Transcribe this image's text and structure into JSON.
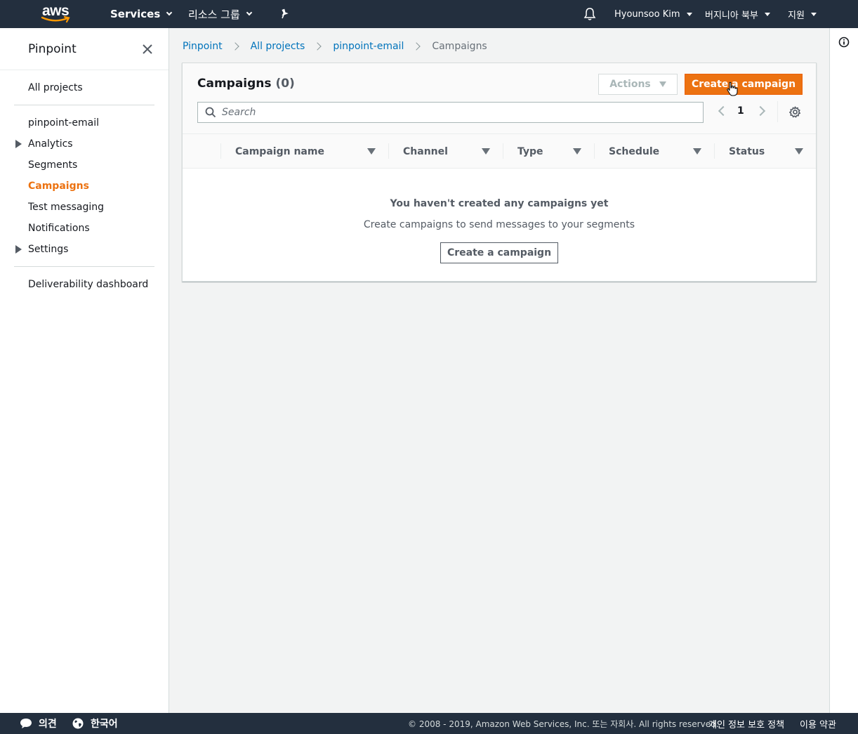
{
  "topnav": {
    "logo_text": "aws",
    "services_label": "Services",
    "resource_groups_label": "리소스 그룹",
    "user_label": "Hyounsoo Kim",
    "region_label": "버지니아 북부",
    "support_label": "지원",
    "icons": [
      "caret-down-icon",
      "pin-icon",
      "bell-icon"
    ]
  },
  "sidebar": {
    "title": "Pinpoint",
    "items": [
      {
        "label": "All projects"
      },
      {
        "label": "pinpoint-email"
      },
      {
        "label": "Analytics",
        "expandable": true
      },
      {
        "label": "Segments"
      },
      {
        "label": "Campaigns",
        "active": true
      },
      {
        "label": "Test messaging"
      },
      {
        "label": "Notifications"
      },
      {
        "label": "Settings",
        "expandable": true
      },
      {
        "label": "Deliverability dashboard"
      }
    ],
    "active_color": "#ec7211"
  },
  "breadcrumb": {
    "items": [
      "Pinpoint",
      "All projects",
      "pinpoint-email",
      "Campaigns"
    ]
  },
  "campaigns": {
    "title": "Campaigns",
    "count": "(0)",
    "actions_label": "Actions",
    "create_label": "Create a campaign",
    "search_placeholder": "Search",
    "page": "1",
    "columns": [
      "Campaign name",
      "Channel",
      "Type",
      "Schedule",
      "Status"
    ],
    "empty_title": "You haven't created any campaigns yet",
    "empty_desc": "Create campaigns to send messages to your segments",
    "empty_button": "Create a campaign",
    "primary_color": "#ec7211"
  },
  "footer": {
    "feedback_label": "의견",
    "language_label": "한국어",
    "copyright": "© 2008 - 2019, Amazon Web Services, Inc. 또는 자회사. All rights reserved.",
    "privacy_label": "개인 정보 보호 정책",
    "terms_label": "이용 약관"
  }
}
